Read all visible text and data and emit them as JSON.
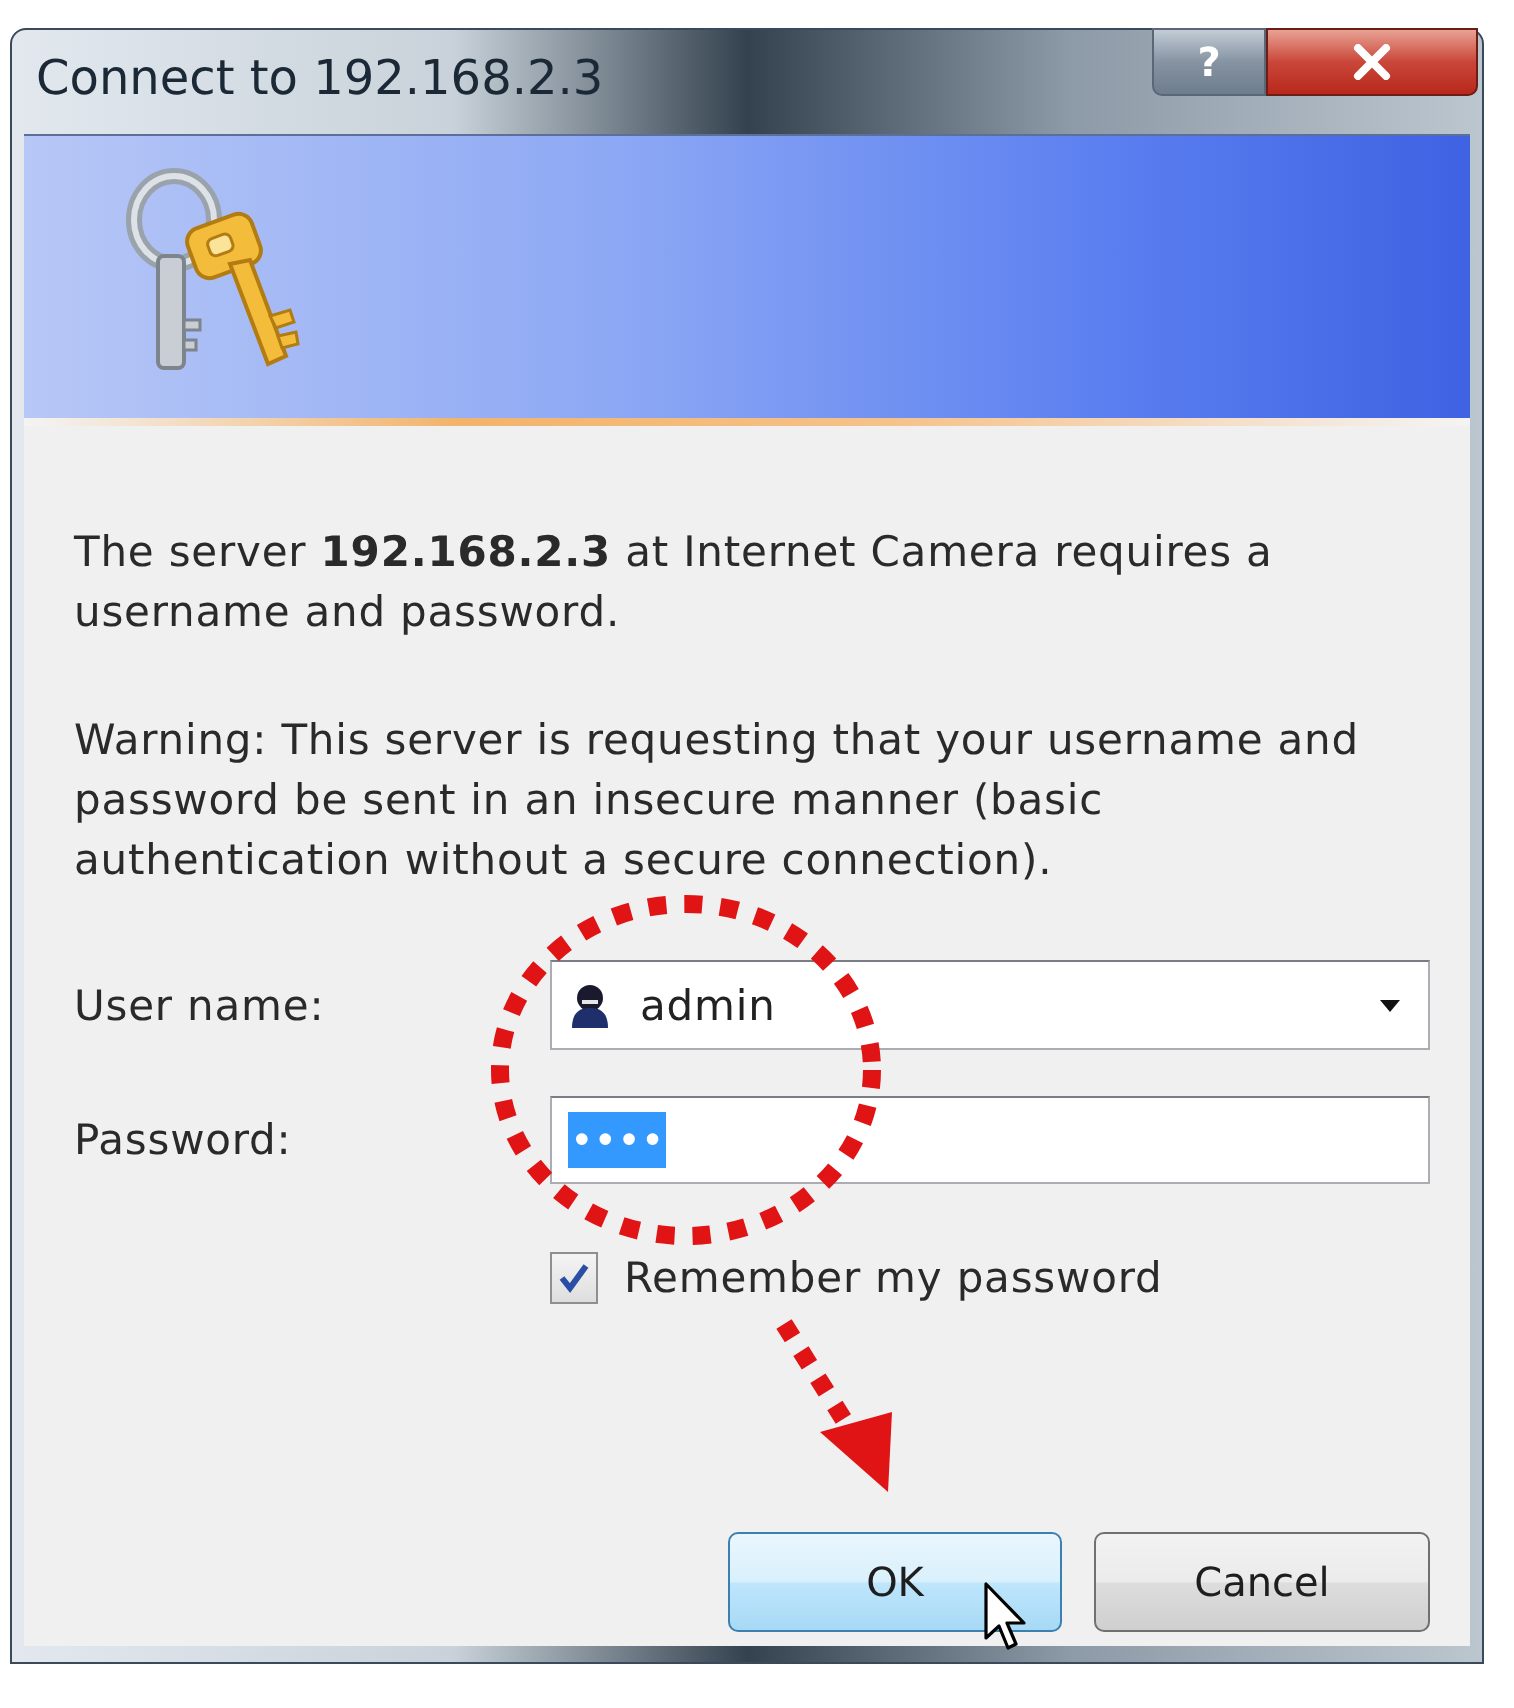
{
  "window": {
    "title": "Connect to 192.168.2.3"
  },
  "title_buttons": [
    {
      "kind": "help",
      "label": "?"
    },
    {
      "kind": "close"
    }
  ],
  "message": "The server **192.168.2.3** at Internet Camera requires a username and password.",
  "warning": "Warning: This server is requesting that your username and password be sent in an insecure manner (basic authentication without a secure connection).",
  "fields": [
    {
      "kind": "combo",
      "label": "User name:",
      "value": "admin",
      "highlighted": false
    },
    {
      "kind": "password",
      "label": "Password:",
      "value": "••••",
      "highlighted": true
    }
  ],
  "remember_password": {
    "label": "Remember my password",
    "checked": true
  },
  "buttons": [
    {
      "label": "OK",
      "default": true
    },
    {
      "label": "Cancel",
      "default": false
    }
  ]
}
